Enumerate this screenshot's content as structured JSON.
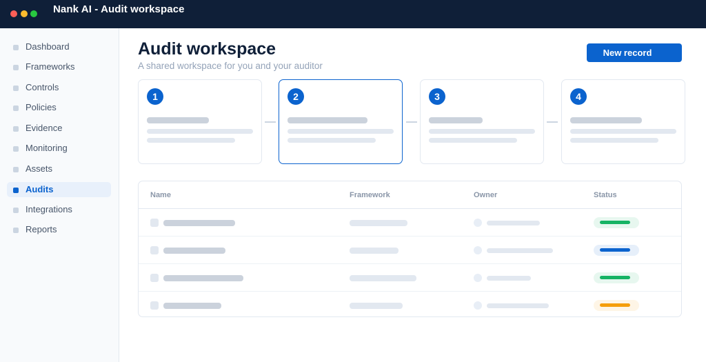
{
  "window": {
    "title": "Nank AI  -  Audit workspace"
  },
  "sidebar": {
    "items": [
      {
        "label": "Dashboard",
        "active": false
      },
      {
        "label": "Frameworks",
        "active": false
      },
      {
        "label": "Controls",
        "active": false
      },
      {
        "label": "Policies",
        "active": false
      },
      {
        "label": "Evidence",
        "active": false
      },
      {
        "label": "Monitoring",
        "active": false
      },
      {
        "label": "Assets",
        "active": false
      },
      {
        "label": "Audits",
        "active": true
      },
      {
        "label": "Integrations",
        "active": false
      },
      {
        "label": "Reports",
        "active": false
      }
    ]
  },
  "header": {
    "title": "Audit workspace",
    "subtitle": "A shared workspace for you and your auditor",
    "new_button_label": "New record"
  },
  "steps": [
    {
      "number": "1",
      "active": false
    },
    {
      "number": "2",
      "active": true
    },
    {
      "number": "3",
      "active": false
    },
    {
      "number": "4",
      "active": false
    }
  ],
  "table": {
    "columns": [
      "Name",
      "Framework",
      "Owner",
      "Status"
    ],
    "rows": [
      {
        "status_color": "#16b364"
      },
      {
        "status_color": "#0b63ce"
      },
      {
        "status_color": "#16b364"
      },
      {
        "status_color": "#f59e0b"
      }
    ]
  },
  "colors": {
    "accent": "#0b63ce",
    "titlebar": "#0f1f38",
    "status_success": "#16b364",
    "status_info": "#0b63ce",
    "status_warning": "#f59e0b"
  }
}
